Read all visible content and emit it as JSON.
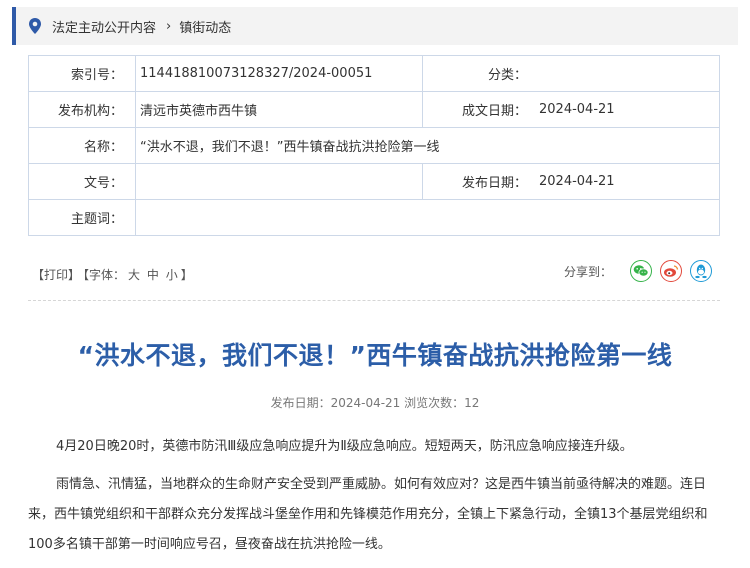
{
  "breadcrumb": {
    "items": [
      "法定主动公开内容",
      "镇街动态"
    ],
    "separator": "›"
  },
  "meta": {
    "index_label": "索引号：",
    "index_value": "114418810073128327/2024-00051",
    "category_label": "分类：",
    "category_value": "",
    "publisher_label": "发布机构：",
    "publisher_value": "清远市英德市西牛镇",
    "created_label": "成文日期：",
    "created_value": "2024-04-21",
    "name_label": "名称：",
    "name_value": "“洪水不退，我们不退！”西牛镇奋战抗洪抢险第一线",
    "docno_label": "文号：",
    "docno_value": "",
    "pubdate_label": "发布日期：",
    "pubdate_value": "2024-04-21",
    "subject_label": "主题词：",
    "subject_value": ""
  },
  "tools": {
    "print": "【打印】",
    "font_prefix": "【字体：",
    "font_large": "大",
    "font_medium": "中",
    "font_small": "小",
    "font_suffix": "】"
  },
  "share": {
    "label": "分享到：",
    "icons": [
      "wechat-icon",
      "weibo-icon",
      "qq-icon"
    ]
  },
  "article": {
    "title": "“洪水不退，我们不退！”西牛镇奋战抗洪抢险第一线",
    "pubinfo": "发布日期：2024-04-21  浏览次数：12",
    "paragraphs": [
      "4月20日晚20时，英德市防汛Ⅲ级应急响应提升为Ⅱ级应急响应。短短两天，防汛应急响应接连升级。",
      "雨情急、汛情猛，当地群众的生命财产安全受到严重威胁。如何有效应对？这是西牛镇当前亟待解决的难题。连日来，西牛镇党组织和干部群众充分发挥战斗堡垒作用和先锋模范作用充分，全镇上下紧急行动，全镇13个基层党组织和100多名镇干部第一时间响应号召，昼夜奋战在抗洪抢险一线。"
    ]
  },
  "colors": {
    "accent": "#2f5aa8",
    "title": "#2c5ea8",
    "wechat": "#36b34a",
    "weibo": "#e2483b",
    "qq": "#1e9ad6"
  }
}
